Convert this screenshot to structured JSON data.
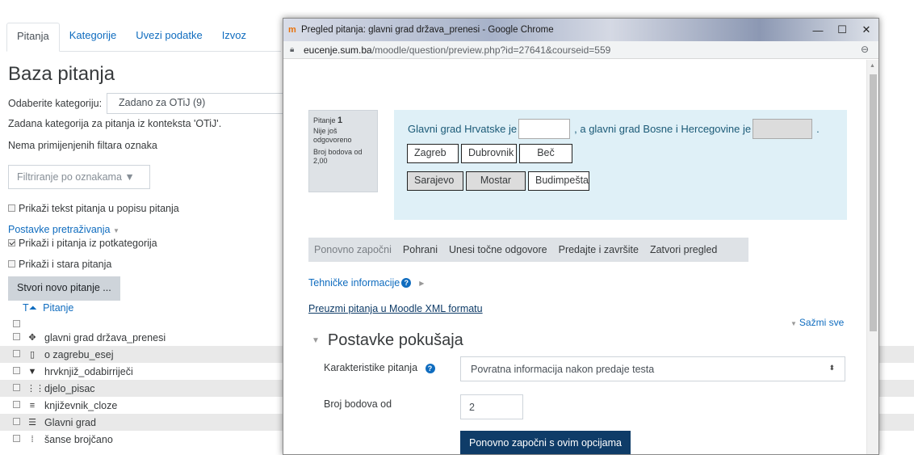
{
  "background": {
    "tabs": [
      "Pitanja",
      "Kategorije",
      "Uvezi podatke",
      "Izvoz"
    ],
    "page_title": "Baza pitanja",
    "category_label": "Odaberite kategoriju:",
    "category_value": "Zadano za OTiJ (9)",
    "context_text": "Zadana kategorija za pitanja iz konteksta 'OTiJ'.",
    "no_filters_text": "Nema primijenjenih filtara oznaka",
    "filter_placeholder": "Filtriranje po oznakama ▼",
    "show_text_label": "Prikaži tekst pitanja u popisu pitanja",
    "search_settings_label": "Postavke pretraživanja",
    "show_subcat_label": "Prikaži i pitanja iz potkategorija",
    "show_old_label": "Prikaži i stara pitanja",
    "new_question_button": "Stvori novo pitanje ...",
    "col_type": "T",
    "col_question": "Pitanje",
    "questions": [
      {
        "icon": "drag-icon",
        "glyph": "✥",
        "name": "glavni grad država_prenesi"
      },
      {
        "icon": "essay-icon",
        "glyph": "▯",
        "name": "o zagrebu_esej"
      },
      {
        "icon": "dropdown-icon",
        "glyph": "▼",
        "name": "hrvknjiž_odabirriječi"
      },
      {
        "icon": "matching-icon",
        "glyph": "⋮⋮",
        "name": "djelo_pisac"
      },
      {
        "icon": "cloze-icon",
        "glyph": "≡",
        "name": "književnik_cloze"
      },
      {
        "icon": "multichoice-icon",
        "glyph": "☰",
        "name": "Glavni grad"
      },
      {
        "icon": "ordering-icon",
        "glyph": "⁞",
        "name": "šanse brojčano"
      }
    ]
  },
  "popup": {
    "window_title": "Pregled pitanja: glavni grad država_prenesi - Google Chrome",
    "url_host": "eucenje.sum.ba",
    "url_path": "/moodle/question/preview.php?id=27641&courseid=559",
    "question_info": {
      "label": "Pitanje",
      "number": "1",
      "status": "Nije još odgovoreno",
      "points": "Broj bodova od 2,00"
    },
    "question_text_1": "Glavni grad Hrvatske je",
    "question_text_2": ", a glavni grad Bosne i Hercegovine je",
    "question_text_3": ".",
    "choices_row1": [
      "Zagreb",
      "Dubrovnik",
      "Beč"
    ],
    "choices_row2": [
      "Sarajevo",
      "Mostar",
      "Budimpešta"
    ],
    "actions": [
      "Ponovno započni",
      "Pohrani",
      "Unesi točne odgovore",
      "Predajte i završite",
      "Zatvori pregled"
    ],
    "tech_info": "Tehničke informacije",
    "xml_link": "Preuzmi pitanja u Moodle XML formatu",
    "collapse_all": "Sažmi sve",
    "section_title": "Postavke pokušaja",
    "behaviour_label": "Karakteristike pitanja",
    "behaviour_value": "Povratna informacija nakon predaje testa",
    "marks_label": "Broj bodova od",
    "marks_value": "2",
    "restart_button": "Ponovno započni s ovim opcijama"
  }
}
